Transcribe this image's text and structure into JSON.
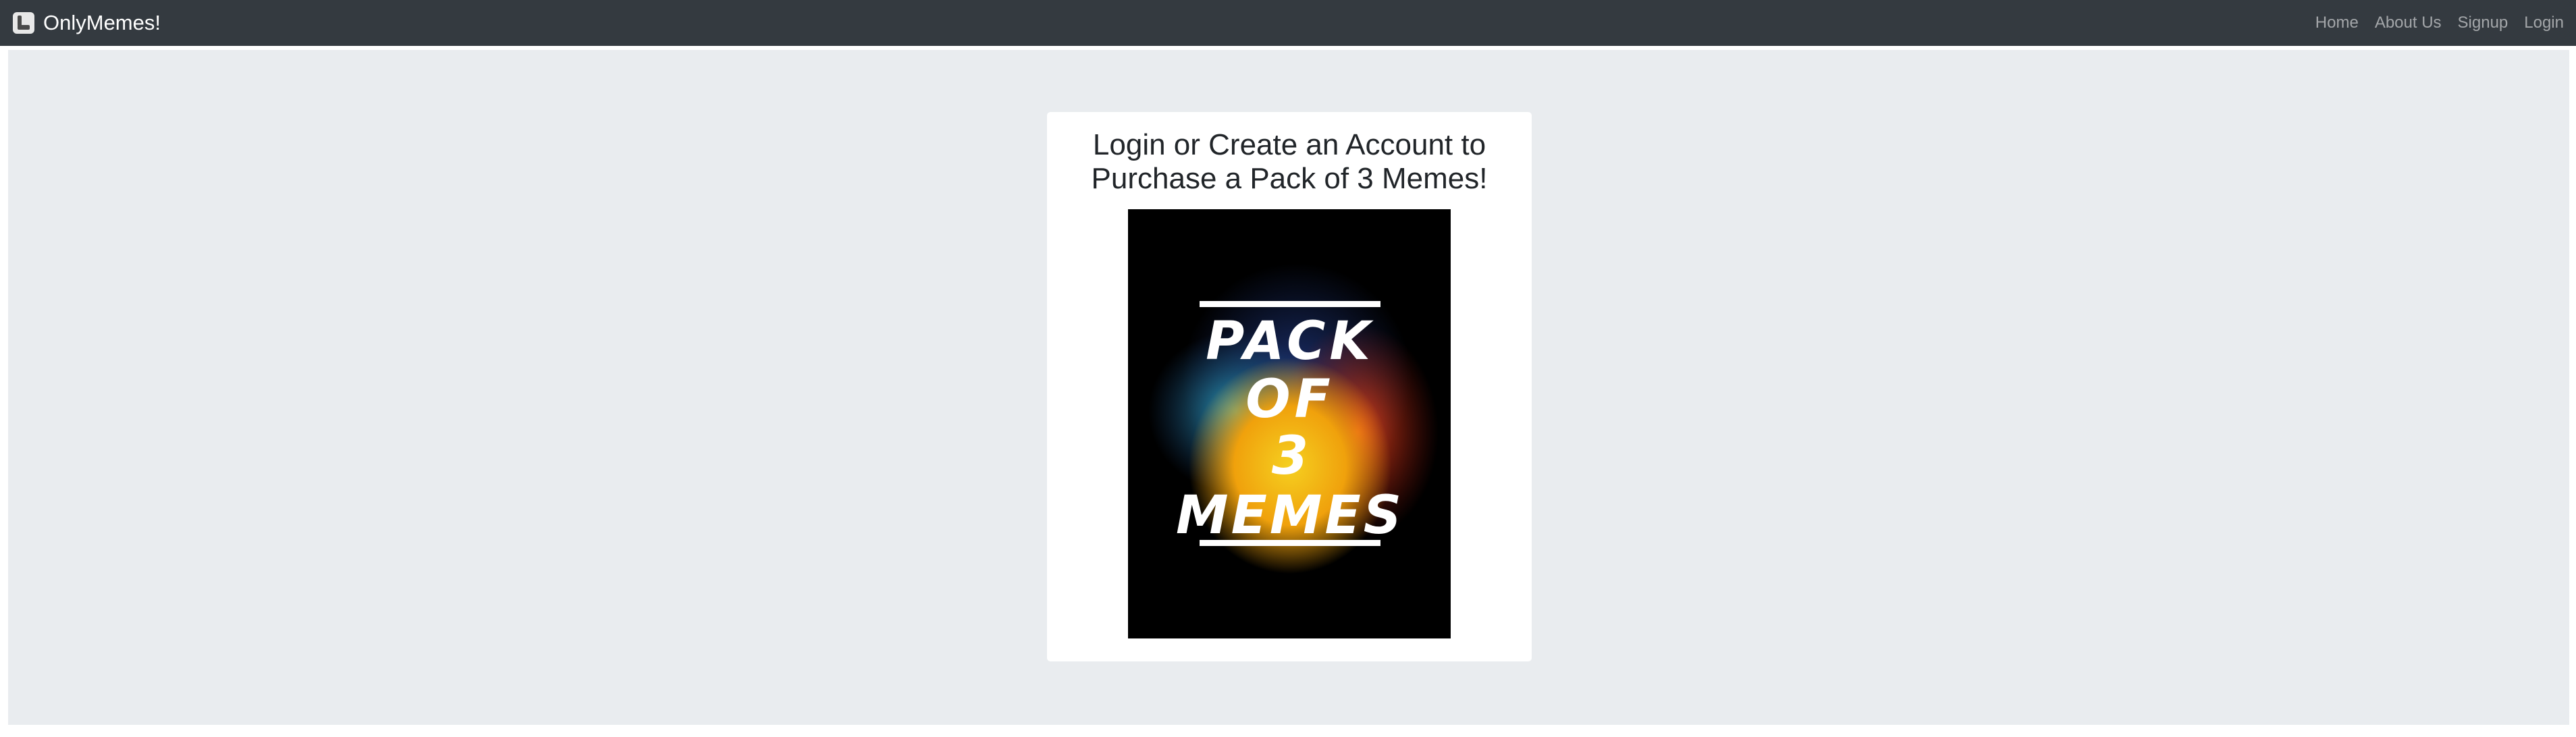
{
  "navbar": {
    "brand": "OnlyMemes!",
    "brand_icon": "user-emoji-icon",
    "links": [
      "Home",
      "About Us",
      "Signup",
      "Login"
    ]
  },
  "card": {
    "title": "Login or Create an Account to Purchase a Pack of 3 Memes!",
    "poster": {
      "lines": [
        "PACK",
        "OF",
        "3",
        "MEMES"
      ]
    }
  },
  "colors": {
    "navbar_bg": "#343a40",
    "page_bg": "#e9ecef",
    "card_bg": "#ffffff",
    "poster_bg": "#000000"
  }
}
